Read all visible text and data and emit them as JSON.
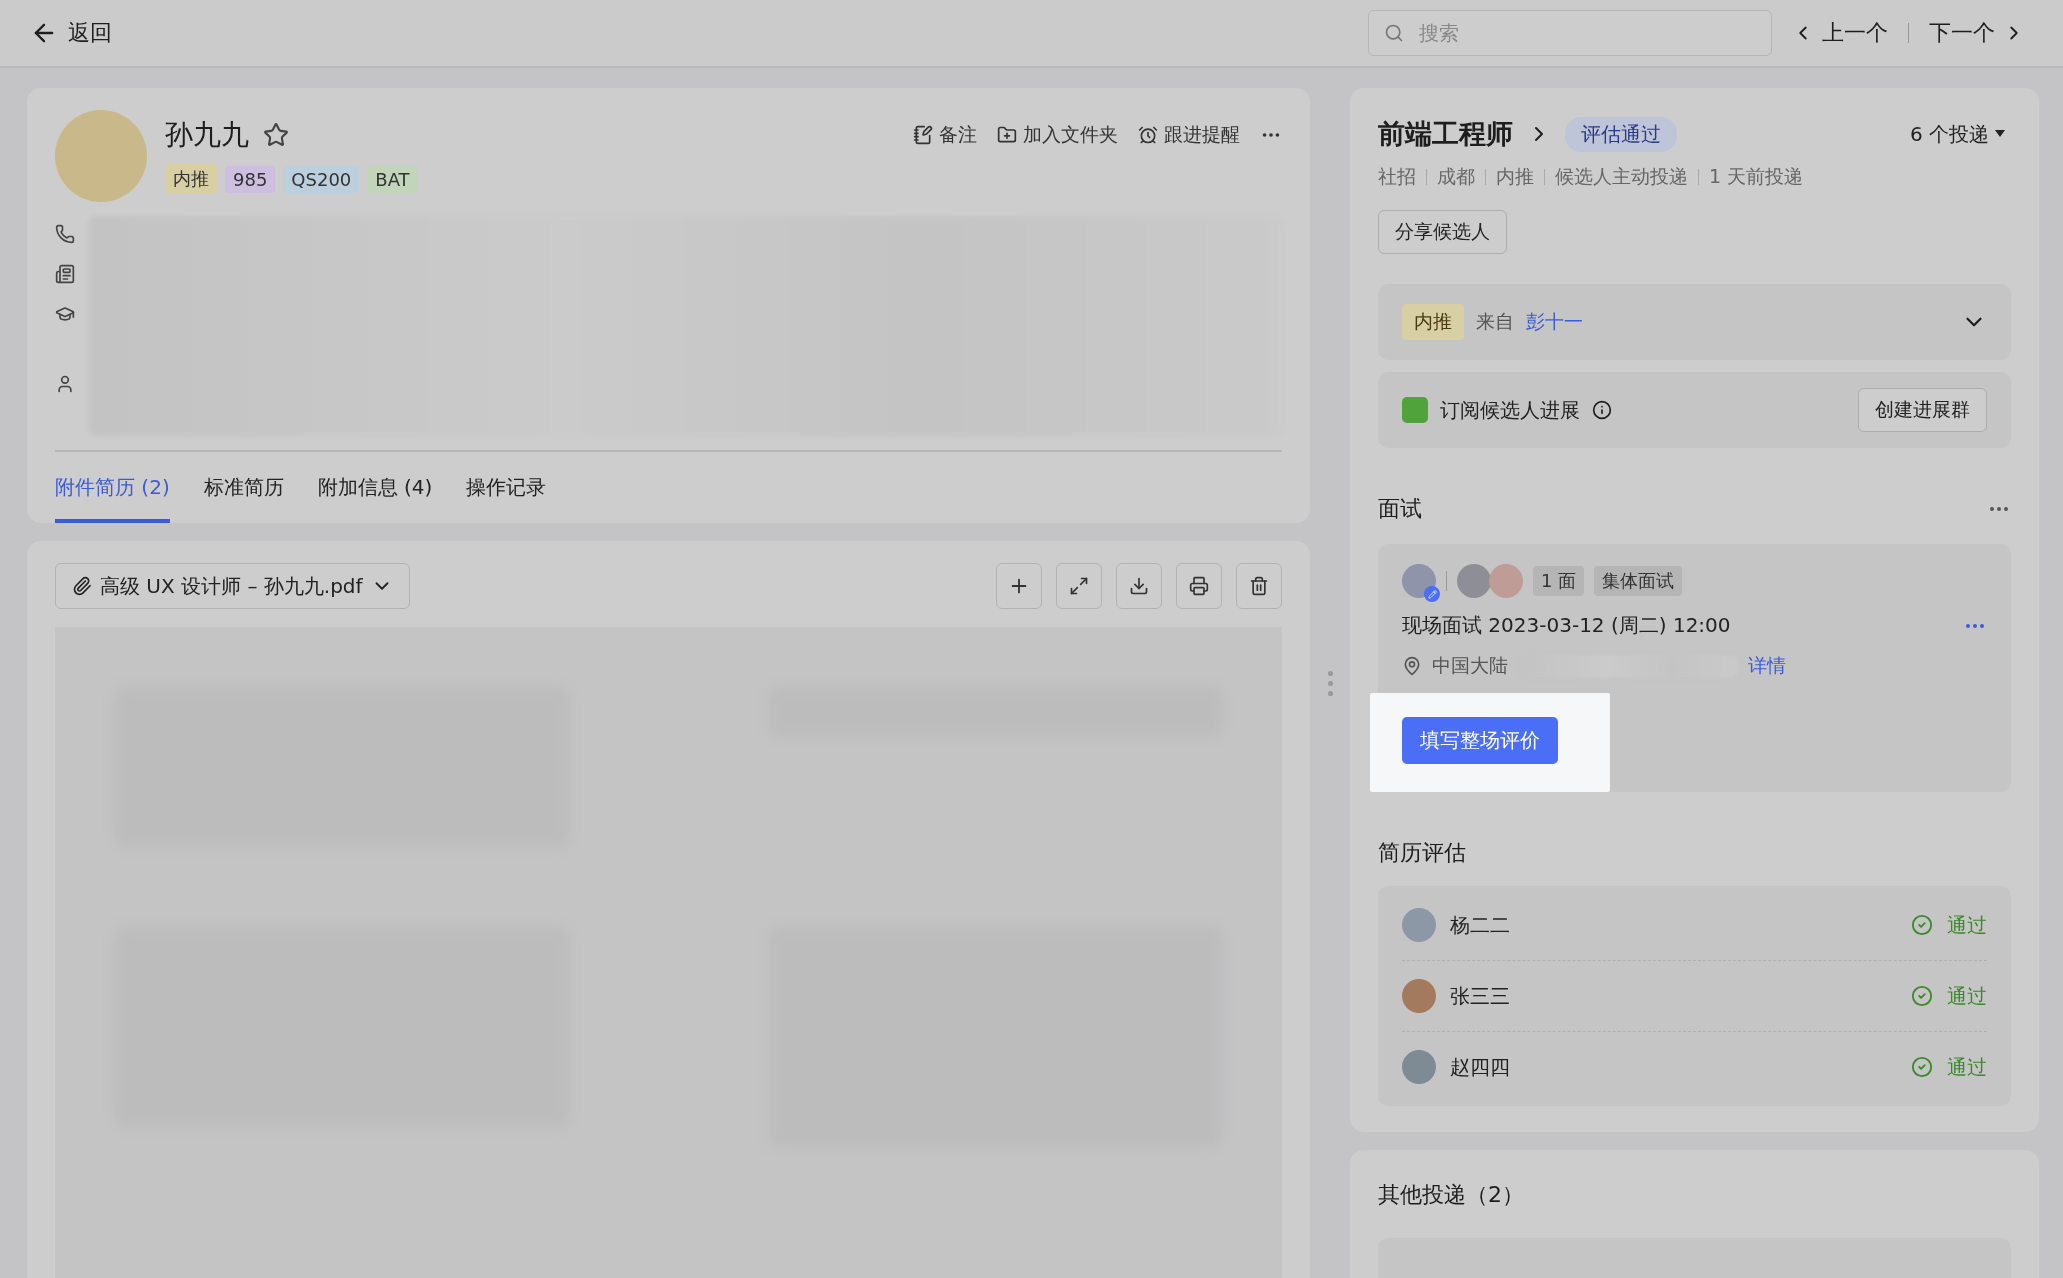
{
  "topbar": {
    "back": "返回",
    "search": {
      "placeholder": "搜索"
    },
    "prev": "上一个",
    "next": "下一个"
  },
  "candidate": {
    "name": "孙九九",
    "starred": false,
    "tags": [
      {
        "label": "内推",
        "color": "#d9cfa5"
      },
      {
        "label": "985",
        "color": "#cdbfdf"
      },
      {
        "label": "QS200",
        "color": "#bccfdc"
      },
      {
        "label": "BAT",
        "color": "#c2d5ba"
      }
    ],
    "actions": [
      {
        "kind": "note",
        "label": "备注"
      },
      {
        "kind": "folder",
        "label": "加入文件夹"
      },
      {
        "kind": "reminder",
        "label": "跟进提醒"
      }
    ]
  },
  "tabs": [
    {
      "label": "附件简历 (2)",
      "selected": true
    },
    {
      "label": "标准简历",
      "selected": false
    },
    {
      "label": "附加信息 (4)",
      "selected": false
    },
    {
      "label": "操作记录",
      "selected": false
    }
  ],
  "attachment": {
    "file": "高级 UX 设计师 – 孙九九.pdf"
  },
  "job": {
    "title": "前端工程师",
    "status": "评估通过",
    "deliveries": "6 个投递",
    "meta": [
      "社招",
      "成都",
      "内推",
      "候选人主动投递",
      "1 天前投递"
    ],
    "share_button": "分享候选人"
  },
  "referral": {
    "tag": "内推",
    "from_label": "来自",
    "referrer": "彭十一"
  },
  "subscribe": {
    "label": "订阅候选人进展",
    "button": "创建进展群"
  },
  "interview": {
    "title": "面试",
    "round": "1 面",
    "type": "集体面试",
    "schedule": "现场面试 2023-03-12 (周二) 12:00",
    "location": "中国大陆",
    "details_link": "详情",
    "action_button": "填写整场评价"
  },
  "resume_review": {
    "title": "简历评估",
    "reviews": [
      {
        "name": "杨二二",
        "result": "通过"
      },
      {
        "name": "张三三",
        "result": "通过"
      },
      {
        "name": "赵四四",
        "result": "通过"
      }
    ]
  },
  "other_deliveries": {
    "title": "其他投递（2）"
  }
}
